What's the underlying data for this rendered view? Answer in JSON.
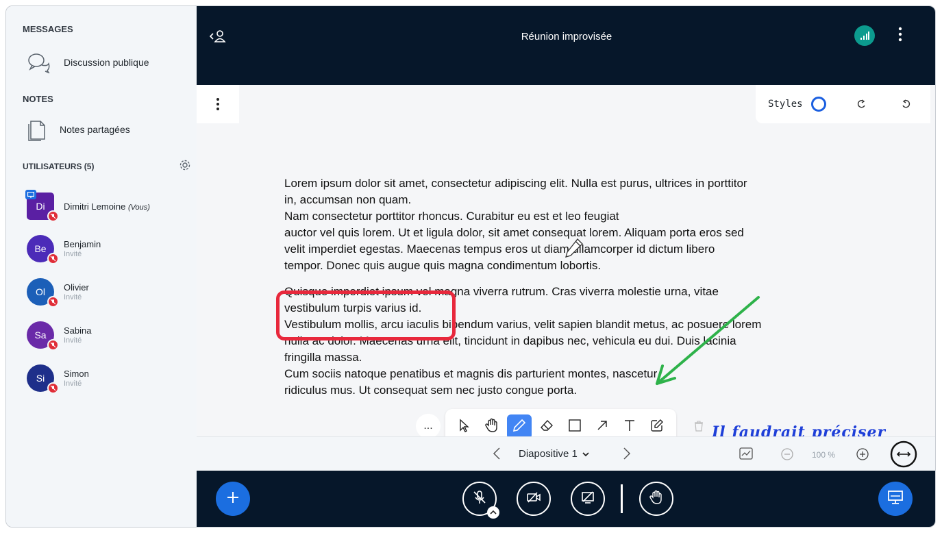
{
  "sidebar": {
    "messages_title": "MESSAGES",
    "public_chat": "Discussion publique",
    "notes_title": "NOTES",
    "shared_notes": "Notes partagées",
    "users_title": "UTILISATEURS (5)",
    "users": [
      {
        "initials": "Di",
        "name": "Dimitri Lemoine",
        "you": "(Vous)",
        "role": "",
        "color": "#5a1fa3",
        "presenter": true
      },
      {
        "initials": "Be",
        "name": "Benjamin",
        "you": "",
        "role": "Invité",
        "color": "#4b2bb8"
      },
      {
        "initials": "Ol",
        "name": "Olivier",
        "you": "",
        "role": "Invité",
        "color": "#1c5fb8"
      },
      {
        "initials": "Sa",
        "name": "Sabina",
        "you": "",
        "role": "Invité",
        "color": "#6a2aa8"
      },
      {
        "initials": "Si",
        "name": "Simon",
        "you": "",
        "role": "Invité",
        "color": "#1e2f8a"
      }
    ]
  },
  "header": {
    "title": "Réunion improvisée"
  },
  "whiteboard": {
    "styles_label": "Styles",
    "paragraph1": [
      "Lorem ipsum dolor sit amet, consectetur adipiscing elit. Nulla est purus, ultrices in porttitor",
      "in, accumsan non quam.",
      "Nam consectetur porttitor rhoncus. Curabitur eu est et leo feugiat",
      "auctor vel quis lorem. Ut et ligula dolor, sit amet consequat lorem. Aliquam porta eros sed",
      "velit imperdiet egestas. Maecenas tempus eros ut diam ullamcorper id dictum libero",
      "tempor. Donec quis augue quis magna condimentum lobortis."
    ],
    "paragraph2": [
      "Quisque imperdiet ipsum vel magna viverra rutrum. Cras viverra molestie urna, vitae",
      "vestibulum turpis varius id.",
      "Vestibulum mollis, arcu iaculis bibendum varius, velit sapien blandit metus, ac posuere lorem",
      "nulla ac dolor. Maecenas urna elit, tincidunt in dapibus nec, vehicula eu dui. Duis lacinia",
      "fringilla massa.",
      "Cum sociis natoque penatibus et magnis dis parturient montes, nascetur",
      "ridiculus mus. Ut consequat sem nec justo congue porta."
    ],
    "handwriting": "Il faudrait préciser",
    "more_label": "..."
  },
  "slide_nav": {
    "label": "Diapositive 1",
    "zoom": "100 %"
  },
  "colors": {
    "header_bg": "#06172a",
    "accent_blue": "#1b6ee0",
    "highlight_red": "#e8283c",
    "arrow_green": "#2eb24a"
  }
}
